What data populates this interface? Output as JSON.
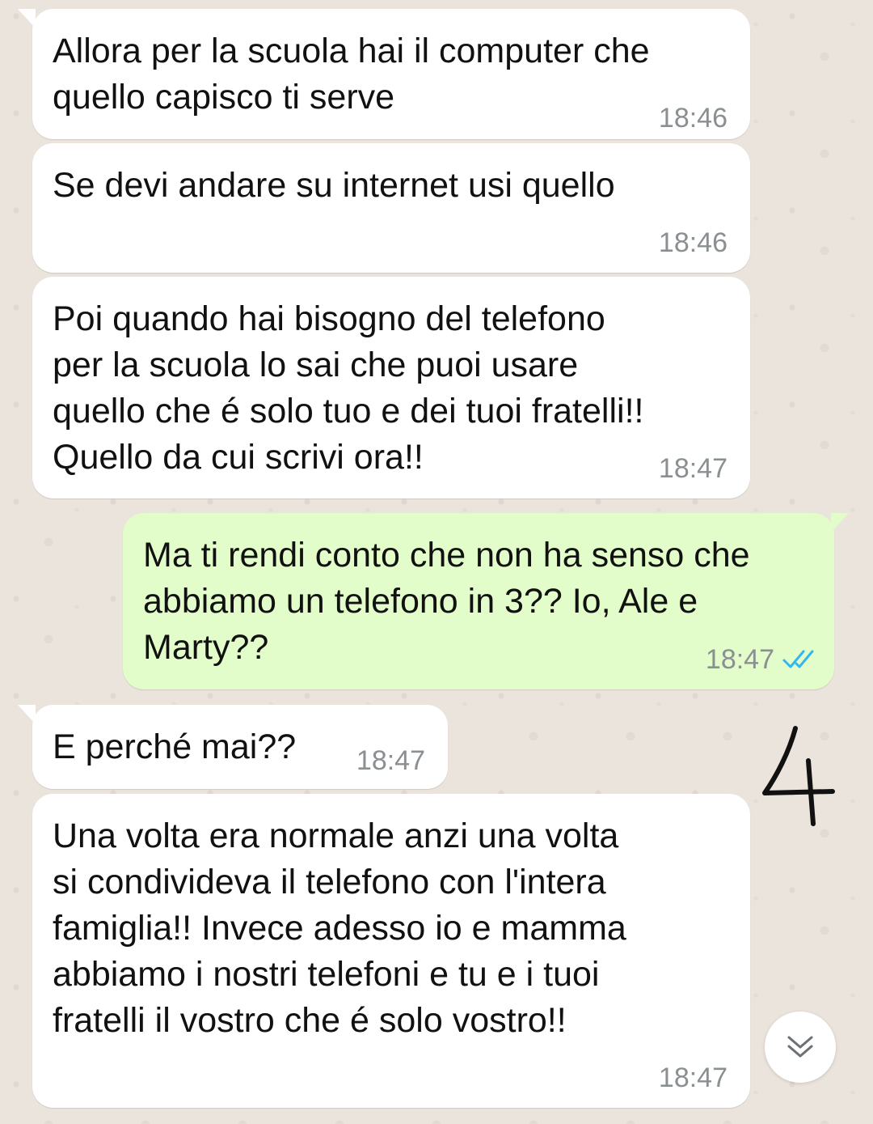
{
  "messages": [
    {
      "text": "Allora per la scuola hai il computer che\nquello capisco ti serve",
      "time": "18:46",
      "direction": "incoming"
    },
    {
      "text": "Se devi andare su internet usi quello",
      "time": "18:46",
      "direction": "incoming"
    },
    {
      "text": "Poi quando hai bisogno del telefono\nper la scuola lo sai che puoi usare\nquello che é solo tuo e dei tuoi fratelli!!\nQuello da cui scrivi ora!!",
      "time": "18:47",
      "direction": "incoming"
    },
    {
      "text": "Ma ti rendi conto che non ha senso che\nabbiamo un telefono in 3?? Io, Ale e\nMarty??",
      "time": "18:47",
      "direction": "outgoing",
      "status": "read"
    },
    {
      "text": "E perché mai??",
      "time": "18:47",
      "direction": "incoming"
    },
    {
      "text": "Una volta era normale anzi una volta\nsi condivideva il telefono con l'intera\nfamiglia!! Invece adesso io e mamma\nabbiamo i nostri telefoni e tu e i tuoi\nfratelli il vostro che é solo vostro!!",
      "time": "18:47",
      "direction": "incoming"
    }
  ],
  "annotation": {
    "text": "4",
    "style": "handwritten"
  },
  "scroll_button": {
    "icon": "double-chevron-down-icon"
  },
  "colors": {
    "incoming_bubble": "#ffffff",
    "outgoing_bubble": "#e2fdc9",
    "wallpaper": "#ebe4dc",
    "timestamp": "#8a8f92",
    "read_ticks": "#34b7f1"
  }
}
